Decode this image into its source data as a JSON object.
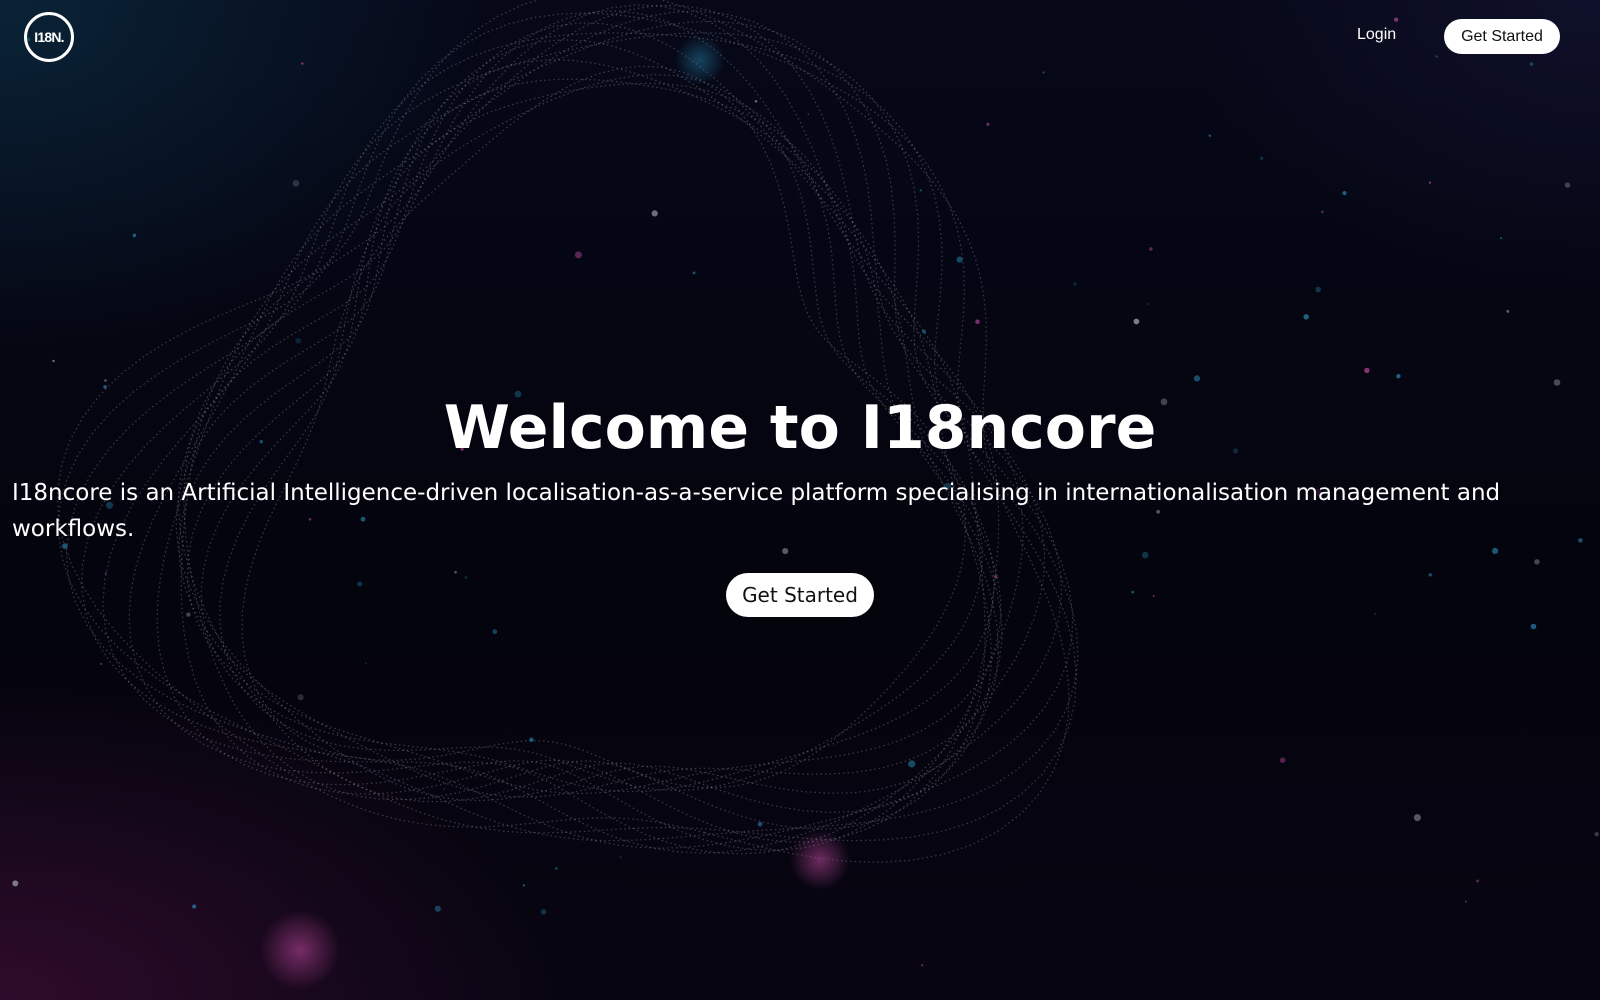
{
  "nav": {
    "logo_text": "I18N.",
    "login_label": "Login",
    "cta_label": "Get Started"
  },
  "hero": {
    "title": "Welcome to I18ncore",
    "description": "I18ncore is an Artificial Intelligence-driven localisation-as-a-service platform specialising in internationalisation management and workflows.",
    "cta_label": "Get Started"
  },
  "theme": {
    "background": "#05040f",
    "text": "#ffffff",
    "button_bg": "#ffffff",
    "button_text": "#111111",
    "particle_blue": "#2a8fb8",
    "particle_magenta": "#c04aa0"
  }
}
